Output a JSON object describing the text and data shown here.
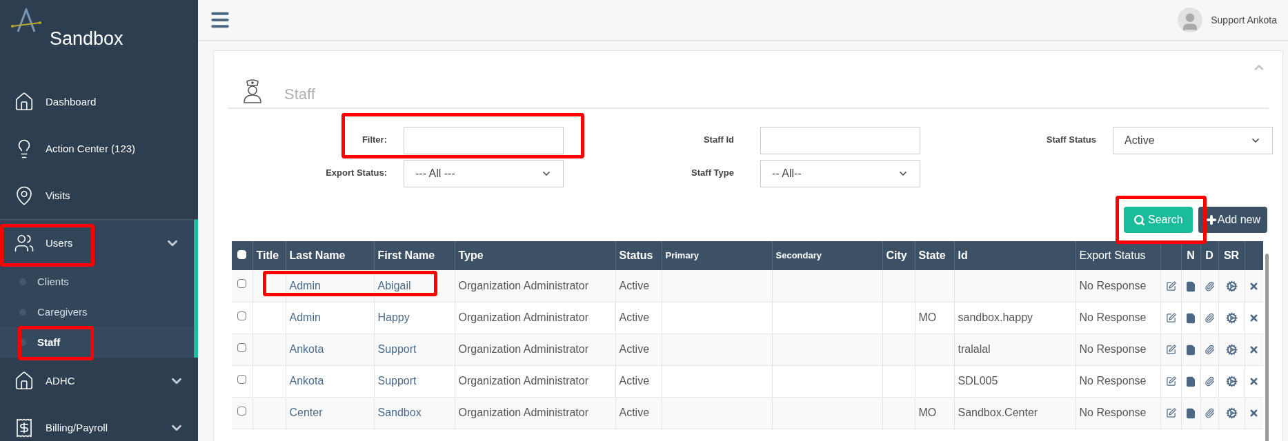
{
  "sidebar": {
    "brand": "Sandbox",
    "items": [
      {
        "label": "Dashboard",
        "kind": "link",
        "selected": false,
        "highlighted": false
      },
      {
        "label": "Action Center (123)",
        "kind": "link",
        "selected": false,
        "highlighted": false
      },
      {
        "label": "Visits",
        "kind": "link",
        "selected": false,
        "highlighted": false
      },
      {
        "label": "Users",
        "kind": "group",
        "expanded": true,
        "highlighted": true,
        "children": [
          {
            "label": "Clients",
            "selected": false,
            "highlighted": false
          },
          {
            "label": "Caregivers",
            "selected": false,
            "highlighted": false
          },
          {
            "label": "Staff",
            "selected": true,
            "highlighted": true
          }
        ]
      },
      {
        "label": "ADHC",
        "kind": "group",
        "expanded": false,
        "highlighted": false
      },
      {
        "label": "Billing/Payroll",
        "kind": "group",
        "expanded": false,
        "highlighted": false
      }
    ]
  },
  "header": {
    "user": "Support Ankota"
  },
  "page": {
    "title": "Staff"
  },
  "filters": {
    "filter": {
      "label": "Filter:",
      "highlighted": true
    },
    "staff_id": {
      "label": "Staff Id"
    },
    "staff_status": {
      "label": "Staff Status",
      "value": "Active"
    },
    "export_status": {
      "label": "Export Status:",
      "value": "--- All ---"
    },
    "staff_type": {
      "label": "Staff Type",
      "value": "-- All--"
    }
  },
  "buttons": {
    "search": {
      "label": "Search",
      "highlighted": true
    },
    "add_new": {
      "label": "Add new"
    }
  },
  "table": {
    "select_all": {
      "checked": false
    },
    "columns": [
      "Title",
      "Last Name",
      "First Name",
      "Type",
      "Status",
      "Primary",
      "Secondary",
      "City",
      "State",
      "Id",
      "Export Status"
    ],
    "action_columns": [
      "N",
      "D",
      "SR"
    ],
    "rows": [
      {
        "checked": false,
        "highlighted": true,
        "last_name": "Admin",
        "first_name": "Abigail",
        "type": "Organization Administrator",
        "status": "Active",
        "export_status": "No Response"
      },
      {
        "checked": false,
        "highlighted": false,
        "last_name": "Admin",
        "first_name": "Happy",
        "type": "Organization Administrator",
        "status": "Active",
        "state": "MO",
        "id": "sandbox.happy",
        "export_status": "No Response"
      },
      {
        "checked": false,
        "highlighted": false,
        "last_name": "Ankota",
        "first_name": "Support",
        "type": "Organization Administrator",
        "status": "Active",
        "id": "tralalal",
        "export_status": "No Response"
      },
      {
        "checked": false,
        "highlighted": false,
        "last_name": "Ankota",
        "first_name": "Support",
        "type": "Organization Administrator",
        "status": "Active",
        "id": "SDL005",
        "export_status": "No Response"
      },
      {
        "checked": false,
        "highlighted": false,
        "last_name": "Center",
        "first_name": "Sandbox",
        "type": "Organization Administrator",
        "status": "Active",
        "state": "MO",
        "id": "Sandbox.Center",
        "export_status": "No Response"
      }
    ]
  }
}
